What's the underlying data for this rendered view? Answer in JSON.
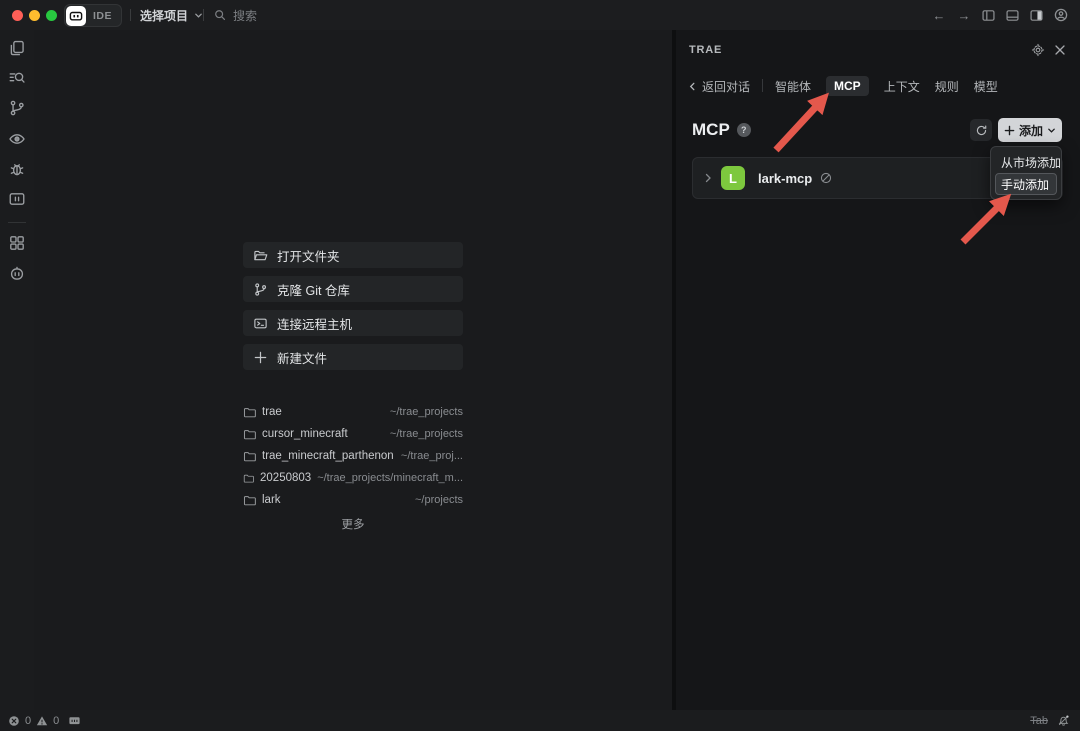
{
  "titlebar": {
    "badge": "IDE",
    "project_selector": "选择项目",
    "search_placeholder": "搜索"
  },
  "welcome": {
    "actions": [
      {
        "label": "打开文件夹",
        "icon": "folder-open-icon"
      },
      {
        "label": "克隆 Git 仓库",
        "icon": "git-branch-icon"
      },
      {
        "label": "连接远程主机",
        "icon": "remote-host-icon"
      },
      {
        "label": "新建文件",
        "icon": "plus-icon"
      }
    ],
    "recent": [
      {
        "name": "trae",
        "path": "~/trae_projects"
      },
      {
        "name": "cursor_minecraft",
        "path": "~/trae_projects"
      },
      {
        "name": "trae_minecraft_parthenon",
        "path": "~/trae_proj..."
      },
      {
        "name": "20250803",
        "path": "~/trae_projects/minecraft_m..."
      },
      {
        "name": "lark",
        "path": "~/projects"
      }
    ],
    "more_label": "更多"
  },
  "panel": {
    "title": "TRAE",
    "back_label": "返回对话",
    "tabs": [
      {
        "label": "智能体"
      },
      {
        "label": "MCP"
      },
      {
        "label": "上下文"
      },
      {
        "label": "规则"
      },
      {
        "label": "模型"
      }
    ],
    "active_tab": "MCP",
    "section_title": "MCP",
    "add_label": "添加",
    "dropdown_items": [
      {
        "label": "从市场添加"
      },
      {
        "label": "手动添加"
      }
    ],
    "highlighted_item": "手动添加",
    "server": {
      "name": "lark-mcp",
      "initial": "L"
    }
  },
  "statusbar": {
    "errors": "0",
    "warnings": "0",
    "tab_label": "Tab"
  },
  "colors": {
    "annotation_arrow": "#E4584C",
    "server_icon_bg": "#7DC83E",
    "add_button_bg": "#D3D5D8",
    "traffic_red": "#FF5F57",
    "traffic_yellow": "#FEBC2E",
    "traffic_green": "#28C840"
  }
}
